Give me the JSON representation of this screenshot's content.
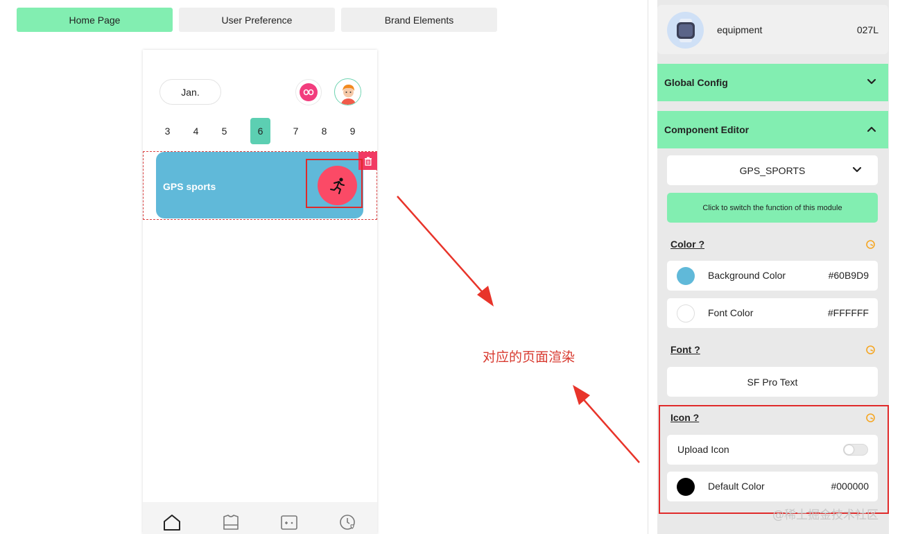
{
  "tabs": [
    {
      "label": "Home Page",
      "active": true
    },
    {
      "label": "User Preference",
      "active": false
    },
    {
      "label": "Brand Elements",
      "active": false
    }
  ],
  "preview": {
    "month": "Jan.",
    "days": [
      "3",
      "4",
      "5",
      "6",
      "7",
      "8",
      "9"
    ],
    "selected_day": "6",
    "card": {
      "title": "GPS sports",
      "background_color": "#60B9D9",
      "font_color": "#FFFFFF",
      "icon": "running-person-icon"
    },
    "nav_icons": [
      "home-icon",
      "shirt-icon",
      "gamepad-icon",
      "clock-heart-icon"
    ]
  },
  "annotation": {
    "text": "对应的页面渲染",
    "color": "#d83a2f"
  },
  "watermark": "@稀土掘金技术社区",
  "panel": {
    "device": {
      "name": "equipment",
      "code": "027L",
      "icon": "smartwatch-icon"
    },
    "global_config": {
      "label": "Global Config",
      "expanded": false
    },
    "component_editor": {
      "label": "Component Editor",
      "expanded": true,
      "module_select": "GPS_SPORTS",
      "switch_button": "Click to switch the function of this module",
      "color_section": {
        "label": "Color ?",
        "background": {
          "label": "Background Color",
          "value": "#60B9D9"
        },
        "font": {
          "label": "Font Color",
          "value": "#FFFFFF"
        }
      },
      "font_section": {
        "label": "Font ?",
        "value": "SF Pro Text"
      },
      "icon_section": {
        "label": "Icon ?",
        "upload": {
          "label": "Upload Icon",
          "enabled": false
        },
        "default_color": {
          "label": "Default Color",
          "value": "#000000"
        }
      }
    }
  },
  "colors": {
    "accent_green": "#82eeb1",
    "selected_day": "#5ccfb2",
    "highlight_red": "#e02a2a",
    "run_button": "#fb4a66",
    "help_icon": "#f5a623"
  }
}
